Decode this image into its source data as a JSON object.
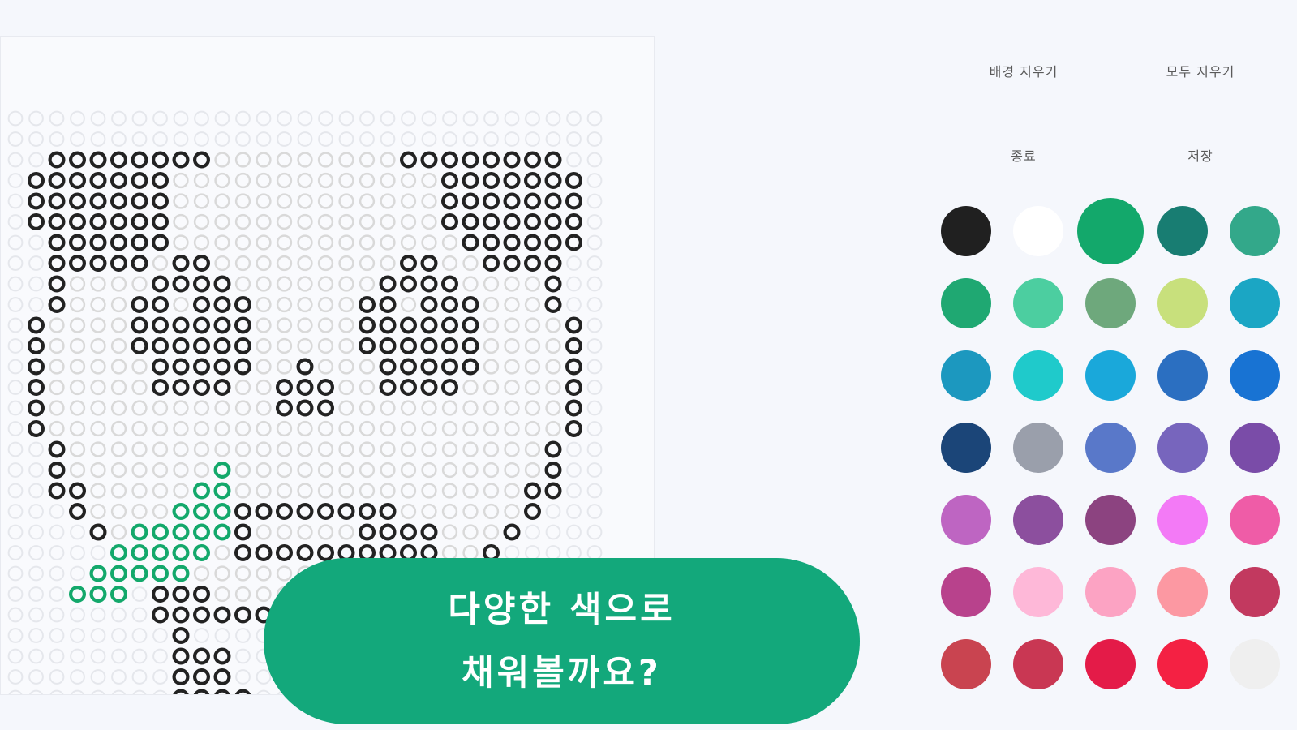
{
  "menu": {
    "clear_background_label": "배경 지우기",
    "clear_all_label": "모두 지우기",
    "exit_label": "종료",
    "save_label": "저장"
  },
  "palette": {
    "selected_index": 2,
    "colors": [
      "#202020",
      "#ffffff",
      "#13a86b",
      "#187d72",
      "#33a88a",
      "#1fa872",
      "#4ccea0",
      "#6ea87c",
      "#c8e07c",
      "#1ba6c4",
      "#1c98bf",
      "#1fcacb",
      "#1aa8da",
      "#2b6fc1",
      "#1873d3",
      "#1b4578",
      "#9a9fab",
      "#5978c9",
      "#7765bd",
      "#7a4ca8",
      "#be65c2",
      "#8c4f9e",
      "#8c4380",
      "#f37af6",
      "#ef5ca7",
      "#b8428c",
      "#feb8d8",
      "#fca3c3",
      "#fc98a2",
      "#c2395f",
      "#c94450",
      "#c93753",
      "#e41b48",
      "#f42143",
      "#efefef"
    ]
  },
  "board": {
    "grid_cols": 29,
    "grid_rows": 30,
    "colors": {
      "bead_outline": "#222222",
      "leaf": "#13a86b",
      "face": "#d9d9d9",
      "empty": "#e5e7ec"
    }
  },
  "banner": {
    "line1": "다양한 색으로",
    "line2": "채워볼까요?"
  }
}
